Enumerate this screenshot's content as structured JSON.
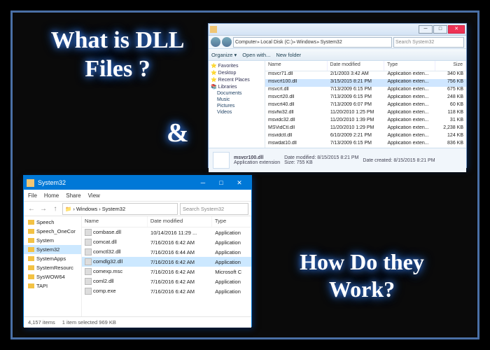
{
  "headline": {
    "q1": "What is DLL Files ?",
    "amp": "&",
    "q2": "How Do they Work?"
  },
  "win7": {
    "crumbs": [
      "Computer",
      "Local Disk (C:)",
      "Windows",
      "System32"
    ],
    "search_placeholder": "Search System32",
    "toolbar": {
      "organize": "Organize ▾",
      "open": "Open with...",
      "newfolder": "New folder"
    },
    "side_groups": [
      {
        "label": "Favorites",
        "items": []
      },
      {
        "label": "Desktop",
        "items": []
      },
      {
        "label": "Recent Places",
        "items": []
      }
    ],
    "side_lib": {
      "label": "Libraries",
      "items": [
        "Documents",
        "Music",
        "Pictures",
        "Videos"
      ]
    },
    "cols": {
      "name": "Name",
      "date": "Date modified",
      "type": "Type",
      "size": "Size"
    },
    "rows": [
      {
        "n": "msvcr71.dll",
        "d": "2/1/2003 3:42 AM",
        "t": "Application exten...",
        "s": "340 KB"
      },
      {
        "n": "msvcrt100.dll",
        "d": "3/15/2015 8:21 PM",
        "t": "Application exten...",
        "s": "756 KB",
        "sel": true
      },
      {
        "n": "msvcrt.dll",
        "d": "7/13/2009 6:15 PM",
        "t": "Application exten...",
        "s": "675 KB"
      },
      {
        "n": "msvcrt20.dll",
        "d": "7/13/2009 6:15 PM",
        "t": "Application exten...",
        "s": "248 KB"
      },
      {
        "n": "msvcrt40.dll",
        "d": "7/13/2009 6:07 PM",
        "t": "Application exten...",
        "s": "60 KB"
      },
      {
        "n": "msvfw32.dll",
        "d": "11/20/2010 1:25 PM",
        "t": "Application exten...",
        "s": "118 KB"
      },
      {
        "n": "msvidc32.dll",
        "d": "11/20/2010 1:39 PM",
        "t": "Application exten...",
        "s": "31 KB"
      },
      {
        "n": "MSVidCtl.dll",
        "d": "11/20/2010 1:29 PM",
        "t": "Application exten...",
        "s": "2,238 KB"
      },
      {
        "n": "msvidctl.dll",
        "d": "6/10/2009 2:21 PM",
        "t": "Application exten...",
        "s": "124 KB"
      },
      {
        "n": "mswdat10.dll",
        "d": "7/13/2009 6:15 PM",
        "t": "Application exten...",
        "s": "836 KB"
      }
    ],
    "details": {
      "name": "msvcr100.dll",
      "type": "Application extension",
      "mod_lbl": "Date modified:",
      "mod": "8/15/2015 8:21 PM",
      "size_lbl": "Size:",
      "size": "755 KB",
      "created_lbl": "Date created:",
      "created": "8/15/2015 8:21 PM"
    }
  },
  "win10": {
    "title": "System32",
    "menu": [
      "File",
      "Home",
      "Share",
      "View"
    ],
    "crumbs": [
      "Windows",
      "System32"
    ],
    "search_placeholder": "Search System32",
    "side": [
      {
        "l": "Speech"
      },
      {
        "l": "Speech_OneCor"
      },
      {
        "l": "System"
      },
      {
        "l": "System32",
        "sel": true
      },
      {
        "l": "SystemApps"
      },
      {
        "l": "SystemResourc"
      },
      {
        "l": "SysWOW64"
      },
      {
        "l": "TAPI"
      }
    ],
    "cols": {
      "name": "Name",
      "date": "Date modified",
      "type": "Type"
    },
    "rows": [
      {
        "n": "combase.dll",
        "d": "10/14/2016 11:29 ...",
        "t": "Application"
      },
      {
        "n": "comcat.dll",
        "d": "7/16/2016 6:42 AM",
        "t": "Application"
      },
      {
        "n": "comctl32.dll",
        "d": "7/16/2016 6:44 AM",
        "t": "Application"
      },
      {
        "n": "comdlg32.dll",
        "d": "7/16/2016 6:42 AM",
        "t": "Application",
        "sel": true
      },
      {
        "n": "comexp.msc",
        "d": "7/16/2016 6:42 AM",
        "t": "Microsoft C"
      },
      {
        "n": "coml2.dll",
        "d": "7/16/2016 6:42 AM",
        "t": "Application"
      },
      {
        "n": "comp.exe",
        "d": "7/16/2016 6:42 AM",
        "t": "Application"
      }
    ],
    "status": {
      "items": "4,157 items",
      "sel": "1 item selected  969 KB"
    }
  }
}
